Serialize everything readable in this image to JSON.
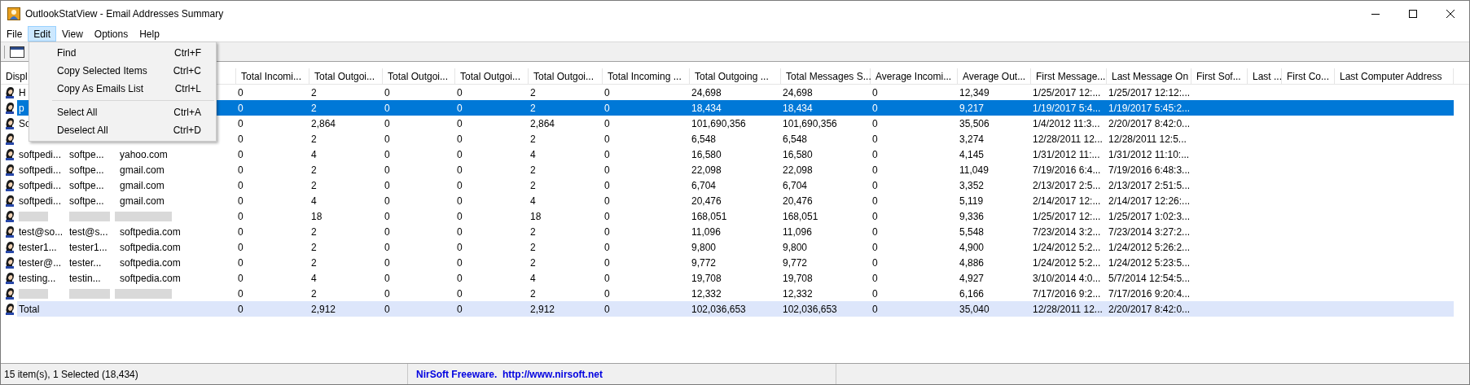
{
  "window": {
    "title": "OutlookStatView  -  Email Addresses Summary"
  },
  "menus": [
    {
      "label": "File",
      "selected": false
    },
    {
      "label": "Edit",
      "selected": true
    },
    {
      "label": "View",
      "selected": false
    },
    {
      "label": "Options",
      "selected": false
    },
    {
      "label": "Help",
      "selected": false
    }
  ],
  "edit_menu": [
    {
      "label": "Find",
      "shortcut": "Ctrl+F"
    },
    {
      "label": "Copy Selected Items",
      "shortcut": "Ctrl+C"
    },
    {
      "label": "Copy As Emails List",
      "shortcut": "Ctrl+L",
      "separator_after": true
    },
    {
      "label": "Select All",
      "shortcut": "Ctrl+A"
    },
    {
      "label": "Deselect All",
      "shortcut": "Ctrl+D"
    }
  ],
  "table": {
    "columns": [
      "Displ",
      "Total Incomi...",
      "Total Outgoi...",
      "Total Outgoi...",
      "Total Outgoi...",
      "Total Outgoi...",
      "Total Incoming ...",
      "Total Outgoing ...",
      "Total Messages S...",
      "Average Incomi...",
      "Average Out...",
      "First Message...",
      "Last Message On",
      "First Sof...",
      "Last ...",
      "First Co...",
      "Last Computer Address"
    ],
    "rows": [
      {
        "kind": "item",
        "selected": false,
        "name": "H",
        "values": [
          "0",
          "2",
          "0",
          "0",
          "2",
          "0",
          "24,698",
          "24,698",
          "0",
          "12,349",
          "1/25/2017 12:...",
          "1/25/2017 12:12:..."
        ]
      },
      {
        "kind": "item",
        "selected": true,
        "name": "p",
        "values": [
          "0",
          "2",
          "0",
          "0",
          "2",
          "0",
          "18,434",
          "18,434",
          "0",
          "9,217",
          "1/19/2017 5:4...",
          "1/19/2017 5:45:2..."
        ]
      },
      {
        "kind": "item",
        "selected": false,
        "name": "So",
        "values": [
          "0",
          "2,864",
          "0",
          "0",
          "2,864",
          "0",
          "101,690,356",
          "101,690,356",
          "0",
          "35,506",
          "1/4/2012 11:3...",
          "2/20/2017 8:42:0..."
        ]
      },
      {
        "kind": "item",
        "selected": false,
        "values": [
          "0",
          "2",
          "0",
          "0",
          "2",
          "0",
          "6,548",
          "6,548",
          "0",
          "3,274",
          "12/28/2011 12...",
          "12/28/2011 12:5..."
        ]
      },
      {
        "kind": "item",
        "selected": false,
        "name": "softpedi...",
        "column_2": "softpe...",
        "column_3": "yahoo.com",
        "values": [
          "0",
          "4",
          "0",
          "0",
          "4",
          "0",
          "16,580",
          "16,580",
          "0",
          "4,145",
          "1/31/2012 11:...",
          "1/31/2012 11:10:..."
        ]
      },
      {
        "kind": "item",
        "selected": false,
        "name": "softpedi...",
        "column_2": "softpe...",
        "column_3": "gmail.com",
        "values": [
          "0",
          "2",
          "0",
          "0",
          "2",
          "0",
          "22,098",
          "22,098",
          "0",
          "11,049",
          "7/19/2016 6:4...",
          "7/19/2016 6:48:3..."
        ]
      },
      {
        "kind": "item",
        "selected": false,
        "name": "softpedi...",
        "column_2": "softpe...",
        "column_3": "gmail.com",
        "values": [
          "0",
          "2",
          "0",
          "0",
          "2",
          "0",
          "6,704",
          "6,704",
          "0",
          "3,352",
          "2/13/2017 2:5...",
          "2/13/2017 2:51:5..."
        ]
      },
      {
        "kind": "item",
        "selected": false,
        "name": "softpedi...",
        "column_2": "softpe...",
        "column_3": "gmail.com",
        "values": [
          "0",
          "4",
          "0",
          "0",
          "4",
          "0",
          "20,476",
          "20,476",
          "0",
          "5,119",
          "2/14/2017 12:...",
          "2/14/2017 12:26:..."
        ]
      },
      {
        "kind": "redacted",
        "selected": false,
        "values": [
          "0",
          "18",
          "0",
          "0",
          "18",
          "0",
          "168,051",
          "168,051",
          "0",
          "9,336",
          "1/25/2017 12:...",
          "1/25/2017 1:02:3..."
        ]
      },
      {
        "kind": "item",
        "selected": false,
        "name": "test@so...",
        "column_2": "test@s...",
        "column_3": "softpedia.com",
        "values": [
          "0",
          "2",
          "0",
          "0",
          "2",
          "0",
          "11,096",
          "11,096",
          "0",
          "5,548",
          "7/23/2014 3:2...",
          "7/23/2014 3:27:2..."
        ]
      },
      {
        "kind": "item",
        "selected": false,
        "name": "tester1...",
        "column_2": "tester1...",
        "column_3": "softpedia.com",
        "values": [
          "0",
          "2",
          "0",
          "0",
          "2",
          "0",
          "9,800",
          "9,800",
          "0",
          "4,900",
          "1/24/2012 5:2...",
          "1/24/2012 5:26:2..."
        ]
      },
      {
        "kind": "item",
        "selected": false,
        "name": "tester@...",
        "column_2": "tester...",
        "column_3": "softpedia.com",
        "values": [
          "0",
          "2",
          "0",
          "0",
          "2",
          "0",
          "9,772",
          "9,772",
          "0",
          "4,886",
          "1/24/2012 5:2...",
          "1/24/2012 5:23:5..."
        ]
      },
      {
        "kind": "item",
        "selected": false,
        "name": "testing...",
        "column_2": "testin...",
        "column_3": "softpedia.com",
        "values": [
          "0",
          "4",
          "0",
          "0",
          "4",
          "0",
          "19,708",
          "19,708",
          "0",
          "4,927",
          "3/10/2014 4:0...",
          "5/7/2014 12:54:5..."
        ]
      },
      {
        "kind": "redacted",
        "selected": false,
        "values": [
          "0",
          "2",
          "0",
          "0",
          "2",
          "0",
          "12,332",
          "12,332",
          "0",
          "6,166",
          "7/17/2016 9:2...",
          "7/17/2016 9:20:4..."
        ]
      },
      {
        "kind": "total",
        "selected": false,
        "name": "Total",
        "values": [
          "0",
          "2,912",
          "0",
          "0",
          "2,912",
          "0",
          "102,036,653",
          "102,036,653",
          "0",
          "35,040",
          "12/28/2011 12...",
          "2/20/2017 8:42:0..."
        ]
      }
    ]
  },
  "status_bar": {
    "count": "15 item(s), 1 Selected (18,434)",
    "credit": "NirSoft Freeware.  http://www.nirsoft.net"
  }
}
